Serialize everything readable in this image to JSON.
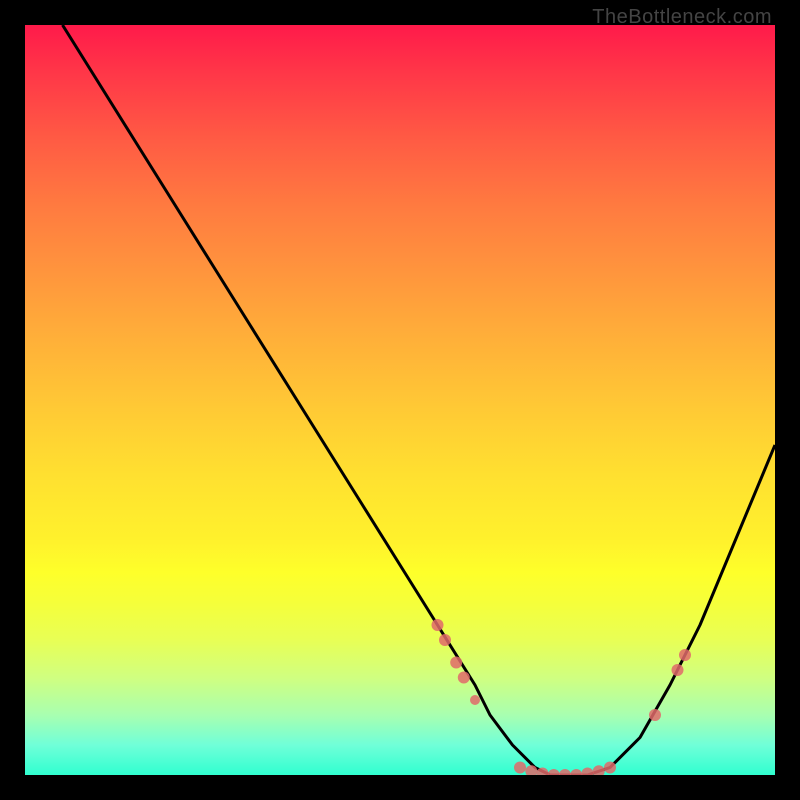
{
  "watermark": "TheBottleneck.com",
  "chart_data": {
    "type": "line",
    "title": "",
    "xlabel": "",
    "ylabel": "",
    "xlim": [
      0,
      100
    ],
    "ylim": [
      0,
      100
    ],
    "grid": false,
    "series": [
      {
        "name": "curve",
        "color": "#000000",
        "x": [
          5,
          10,
          15,
          20,
          25,
          30,
          35,
          40,
          45,
          50,
          55,
          60,
          62,
          65,
          68,
          70,
          73,
          75,
          78,
          82,
          86,
          90,
          95,
          100
        ],
        "y": [
          100,
          92,
          84,
          76,
          68,
          60,
          52,
          44,
          36,
          28,
          20,
          12,
          8,
          4,
          1,
          0,
          0,
          0,
          1,
          5,
          12,
          20,
          32,
          44
        ]
      }
    ],
    "markers": [
      {
        "x": 55,
        "y": 20,
        "r": 6,
        "color": "#e06a6a"
      },
      {
        "x": 56,
        "y": 18,
        "r": 6,
        "color": "#e06a6a"
      },
      {
        "x": 57.5,
        "y": 15,
        "r": 6,
        "color": "#e06a6a"
      },
      {
        "x": 58.5,
        "y": 13,
        "r": 6,
        "color": "#e06a6a"
      },
      {
        "x": 60,
        "y": 10,
        "r": 5,
        "color": "#e06a6a"
      },
      {
        "x": 66,
        "y": 1,
        "r": 6,
        "color": "#e06a6a"
      },
      {
        "x": 67.5,
        "y": 0.5,
        "r": 6,
        "color": "#e06a6a"
      },
      {
        "x": 69,
        "y": 0.2,
        "r": 6,
        "color": "#e06a6a"
      },
      {
        "x": 70.5,
        "y": 0,
        "r": 6,
        "color": "#e06a6a"
      },
      {
        "x": 72,
        "y": 0,
        "r": 6,
        "color": "#e06a6a"
      },
      {
        "x": 73.5,
        "y": 0,
        "r": 6,
        "color": "#e06a6a"
      },
      {
        "x": 75,
        "y": 0.2,
        "r": 6,
        "color": "#e06a6a"
      },
      {
        "x": 76.5,
        "y": 0.5,
        "r": 6,
        "color": "#e06a6a"
      },
      {
        "x": 78,
        "y": 1,
        "r": 6,
        "color": "#e06a6a"
      },
      {
        "x": 84,
        "y": 8,
        "r": 6,
        "color": "#e06a6a"
      },
      {
        "x": 87,
        "y": 14,
        "r": 6,
        "color": "#e06a6a"
      },
      {
        "x": 88,
        "y": 16,
        "r": 6,
        "color": "#e06a6a"
      }
    ]
  }
}
